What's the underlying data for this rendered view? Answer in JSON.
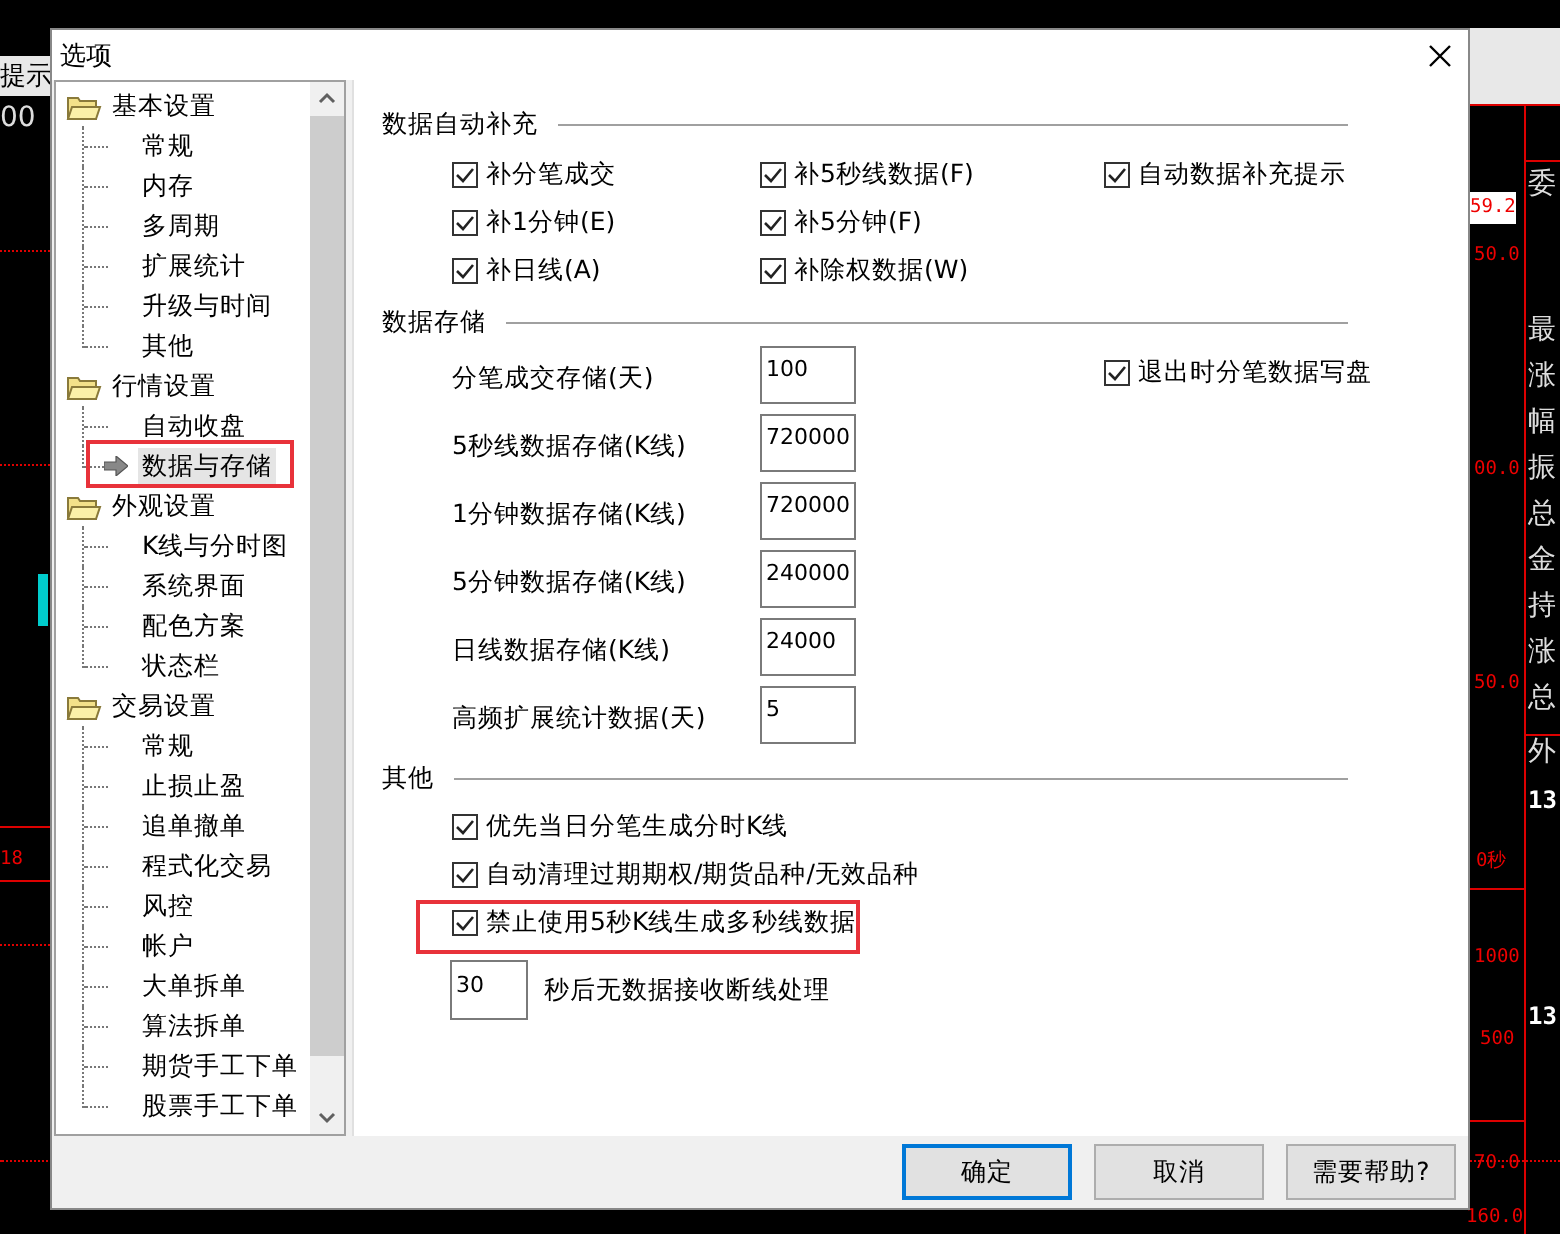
{
  "background_app": {
    "texts": [
      {
        "text": "提示",
        "kind": "tab"
      },
      {
        "text": "00",
        "kind": "label"
      },
      {
        "text": "18",
        "kind": "axis"
      },
      {
        "text": "59.2",
        "kind": "quote"
      },
      {
        "text": "50.0",
        "kind": "axis"
      },
      {
        "text": "00.0",
        "kind": "axis"
      },
      {
        "text": "50.0",
        "kind": "axis"
      },
      {
        "text": "0秒",
        "kind": "axis"
      },
      {
        "text": "1000",
        "kind": "axis"
      },
      {
        "text": "500",
        "kind": "axis"
      },
      {
        "text": "70.0",
        "kind": "axis"
      },
      {
        "text": "160.0",
        "kind": "axis"
      },
      {
        "text": "委",
        "kind": "label"
      },
      {
        "text": "最",
        "kind": "label"
      },
      {
        "text": "涨",
        "kind": "label"
      },
      {
        "text": "幅",
        "kind": "label"
      },
      {
        "text": "振",
        "kind": "label"
      },
      {
        "text": "总",
        "kind": "label"
      },
      {
        "text": "金",
        "kind": "label"
      },
      {
        "text": "持",
        "kind": "label"
      },
      {
        "text": "涨",
        "kind": "label"
      },
      {
        "text": "总",
        "kind": "label"
      },
      {
        "text": "外",
        "kind": "label"
      },
      {
        "text": "13",
        "kind": "time"
      },
      {
        "text": "13",
        "kind": "time"
      }
    ]
  },
  "dialog": {
    "title": "选项"
  },
  "tree": {
    "groups": [
      {
        "label": "基本设置",
        "children": [
          {
            "label": "常规",
            "selected": false,
            "highlighted": false
          },
          {
            "label": "内存",
            "selected": false,
            "highlighted": false
          },
          {
            "label": "多周期",
            "selected": false,
            "highlighted": false
          },
          {
            "label": "扩展统计",
            "selected": false,
            "highlighted": false
          },
          {
            "label": "升级与时间",
            "selected": false,
            "highlighted": false
          },
          {
            "label": "其他",
            "selected": false,
            "highlighted": false
          }
        ]
      },
      {
        "label": "行情设置",
        "children": [
          {
            "label": "自动收盘",
            "selected": false,
            "highlighted": false
          },
          {
            "label": "数据与存储",
            "selected": true,
            "highlighted": true
          }
        ]
      },
      {
        "label": "外观设置",
        "children": [
          {
            "label": "K线与分时图",
            "selected": false,
            "highlighted": false
          },
          {
            "label": "系统界面",
            "selected": false,
            "highlighted": false
          },
          {
            "label": "配色方案",
            "selected": false,
            "highlighted": false
          },
          {
            "label": "状态栏",
            "selected": false,
            "highlighted": false
          }
        ]
      },
      {
        "label": "交易设置",
        "children": [
          {
            "label": "常规",
            "selected": false,
            "highlighted": false
          },
          {
            "label": "止损止盈",
            "selected": false,
            "highlighted": false
          },
          {
            "label": "追单撤单",
            "selected": false,
            "highlighted": false
          },
          {
            "label": "程式化交易",
            "selected": false,
            "highlighted": false
          },
          {
            "label": "风控",
            "selected": false,
            "highlighted": false
          },
          {
            "label": "帐户",
            "selected": false,
            "highlighted": false
          },
          {
            "label": "大单拆单",
            "selected": false,
            "highlighted": false
          },
          {
            "label": "算法拆单",
            "selected": false,
            "highlighted": false
          },
          {
            "label": "期货手工下单",
            "selected": false,
            "highlighted": false
          },
          {
            "label": "股票手工下单",
            "selected": false,
            "highlighted": false
          }
        ]
      }
    ]
  },
  "sections": [
    {
      "title": "数据自动补充",
      "kind": "checkgrid",
      "rows": [
        [
          {
            "label": "补分笔成交",
            "checked": true
          },
          {
            "label": "补5秒线数据(F)",
            "checked": true
          },
          {
            "label": "自动数据补充提示",
            "checked": true
          }
        ],
        [
          {
            "label": "补1分钟(E)",
            "checked": true
          },
          {
            "label": "补5分钟(F)",
            "checked": true
          }
        ],
        [
          {
            "label": "补日线(A)",
            "checked": true
          },
          {
            "label": "补除权数据(W)",
            "checked": true
          }
        ]
      ]
    },
    {
      "title": "数据存储",
      "kind": "storage",
      "fields": [
        {
          "label": "分笔成交存储(天)",
          "value": "100"
        },
        {
          "label": "5秒线数据存储(K线)",
          "value": "720000"
        },
        {
          "label": "1分钟数据存储(K线)",
          "value": "720000"
        },
        {
          "label": "5分钟数据存储(K线)",
          "value": "240000"
        },
        {
          "label": "日线数据存储(K线)",
          "value": "24000"
        },
        {
          "label": "高频扩展统计数据(天)",
          "value": "5"
        }
      ],
      "side_check": {
        "label": "退出时分笔数据写盘",
        "checked": true
      }
    },
    {
      "title": "其他",
      "kind": "misc",
      "checks": [
        {
          "label": "优先当日分笔生成分时K线",
          "checked": true,
          "highlighted": false
        },
        {
          "label": "自动清理过期期权/期货品种/无效品种",
          "checked": true,
          "highlighted": false
        },
        {
          "label": "禁止使用5秒K线生成多秒线数据",
          "checked": true,
          "highlighted": true
        }
      ],
      "timeout": {
        "value": "30",
        "label": "秒后无数据接收断线处理"
      }
    }
  ],
  "buttons": [
    {
      "label": "确定",
      "default": true
    },
    {
      "label": "取消",
      "default": false
    },
    {
      "label": "需要帮助?",
      "default": false
    }
  ]
}
